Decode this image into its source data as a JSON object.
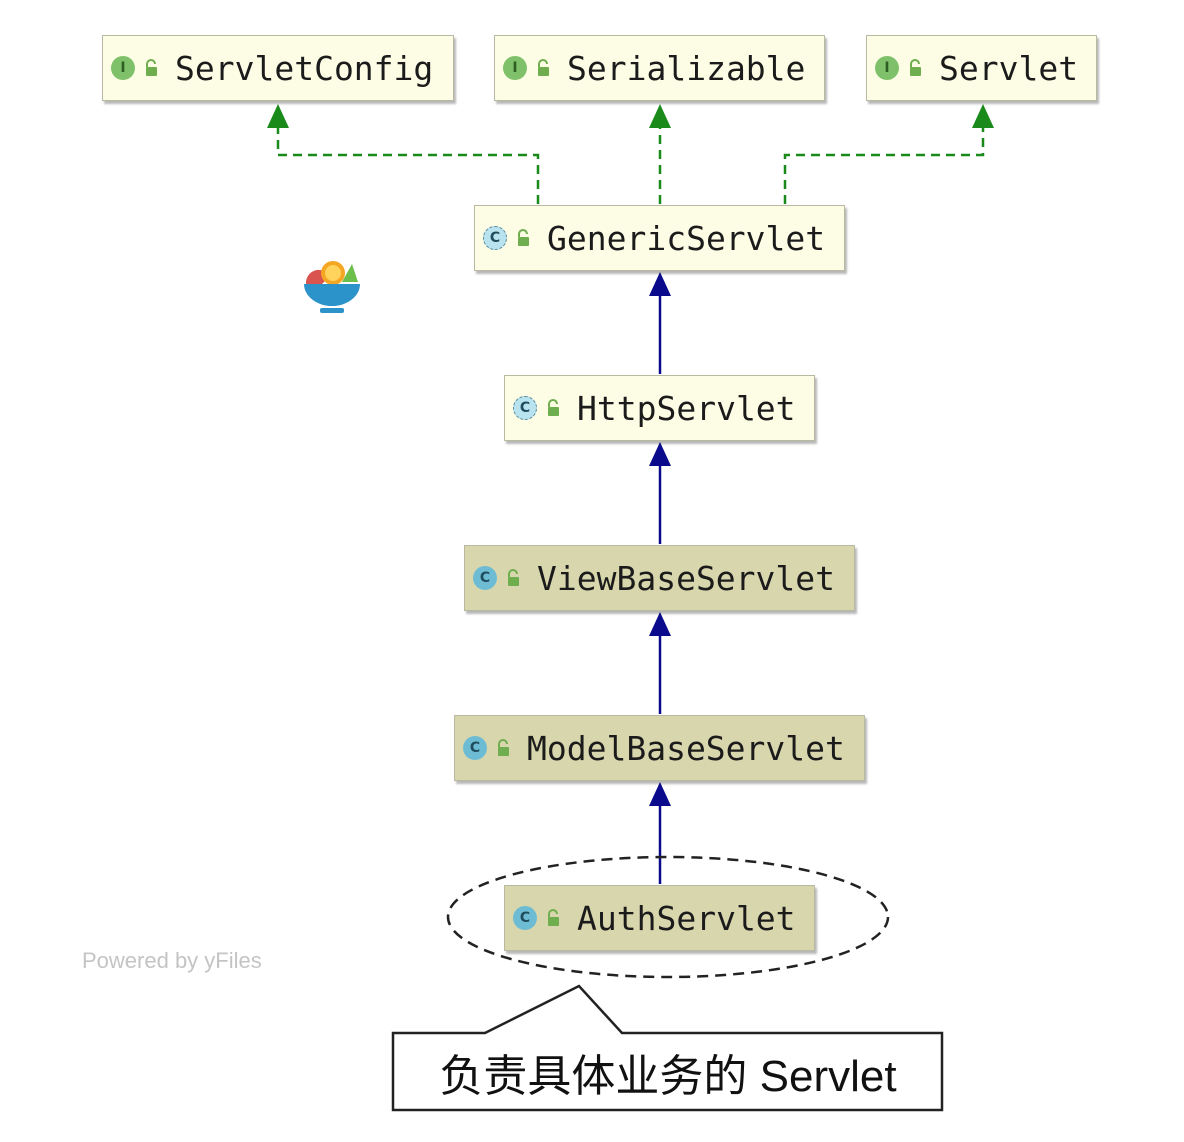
{
  "nodes": [
    {
      "id": "servlet-config",
      "label": "ServletConfig",
      "kind": "interface"
    },
    {
      "id": "serializable",
      "label": "Serializable",
      "kind": "interface"
    },
    {
      "id": "servlet",
      "label": "Servlet",
      "kind": "interface"
    },
    {
      "id": "generic-servlet",
      "label": "GenericServlet",
      "kind": "abstract-class"
    },
    {
      "id": "http-servlet",
      "label": "HttpServlet",
      "kind": "abstract-class"
    },
    {
      "id": "view-base-servlet",
      "label": "ViewBaseServlet",
      "kind": "class"
    },
    {
      "id": "model-base-servlet",
      "label": "ModelBaseServlet",
      "kind": "class"
    },
    {
      "id": "auth-servlet",
      "label": "AuthServlet",
      "kind": "class"
    }
  ],
  "edges": [
    {
      "from": "generic-servlet",
      "to": "servlet-config",
      "type": "implements"
    },
    {
      "from": "generic-servlet",
      "to": "serializable",
      "type": "implements"
    },
    {
      "from": "generic-servlet",
      "to": "servlet",
      "type": "implements"
    },
    {
      "from": "http-servlet",
      "to": "generic-servlet",
      "type": "extends"
    },
    {
      "from": "view-base-servlet",
      "to": "http-servlet",
      "type": "extends"
    },
    {
      "from": "model-base-servlet",
      "to": "view-base-servlet",
      "type": "extends"
    },
    {
      "from": "auth-servlet",
      "to": "model-base-servlet",
      "type": "extends"
    }
  ],
  "icons": {
    "interface": "I",
    "class": "C"
  },
  "colors": {
    "implements_edge": "#1a8a1a",
    "extends_edge": "#0a0a8c",
    "interface_node_fill": "#fdfde6",
    "class_node_fill": "#d8d6ad"
  },
  "highlight": {
    "target": "auth-servlet",
    "callout": "负责具体业务的 Servlet"
  },
  "watermark": "Powered by yFiles"
}
